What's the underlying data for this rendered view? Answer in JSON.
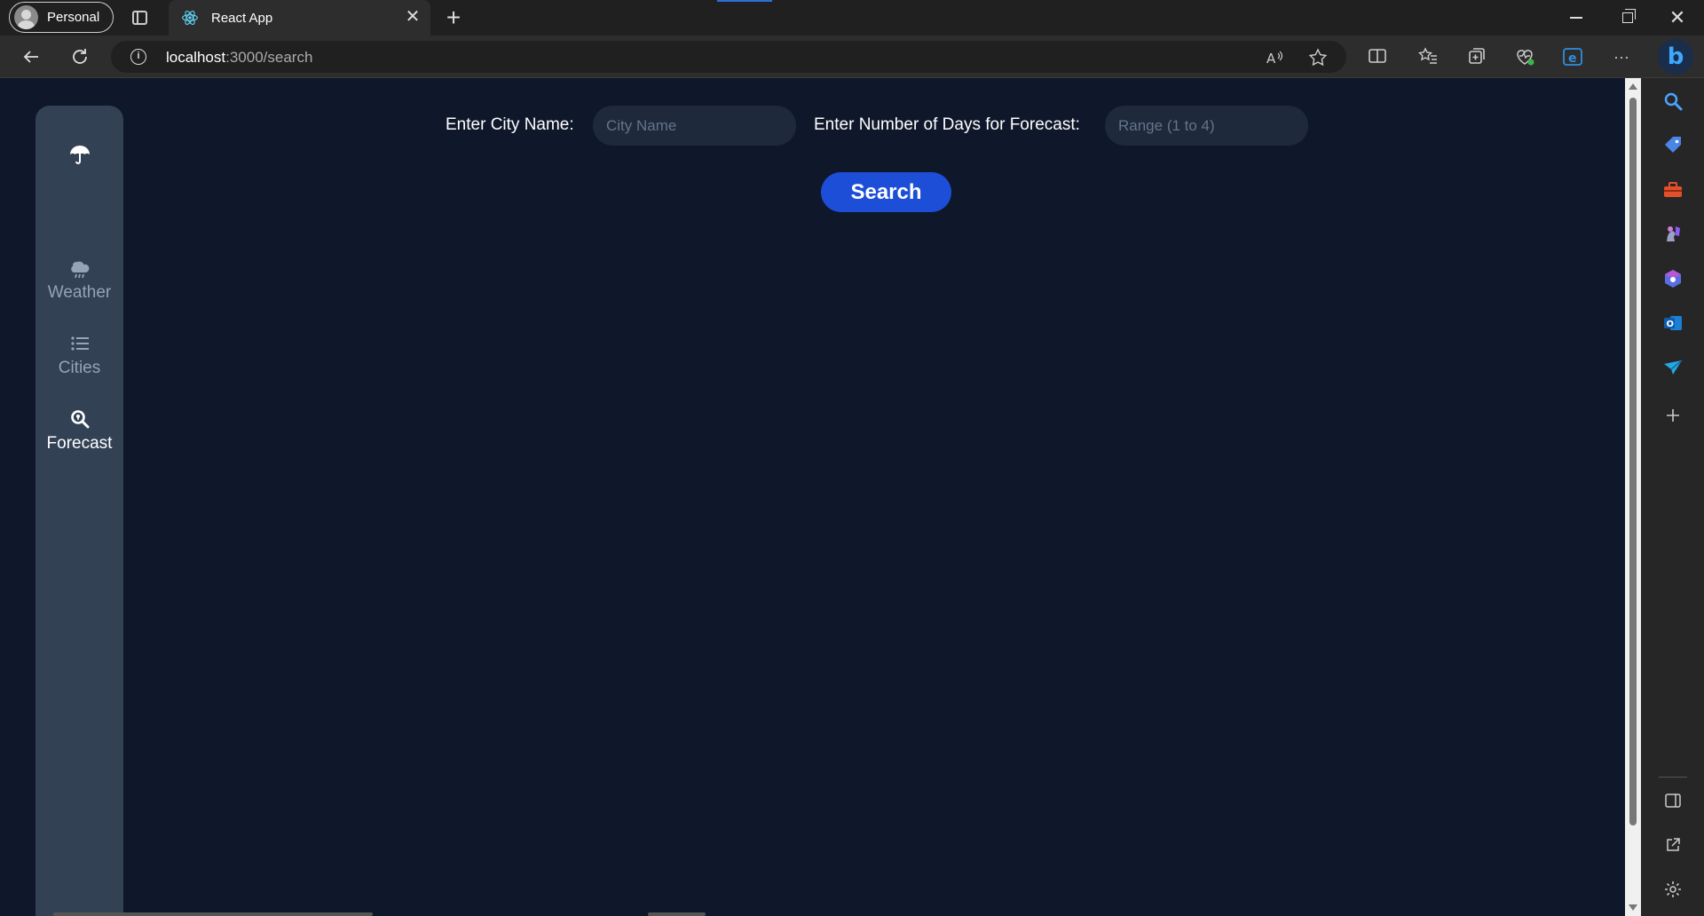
{
  "browser": {
    "profile_label": "Personal",
    "tab_title": "React App",
    "tab_close": "✕",
    "new_tab": "+",
    "url_host": "localhost",
    "url_path": ":3000/search",
    "more_label": "···"
  },
  "sidebar": {
    "items": [
      {
        "label": "Weather",
        "icon": "cloud-rain-icon"
      },
      {
        "label": "Cities",
        "icon": "list-icon"
      },
      {
        "label": "Forecast",
        "icon": "search-location-icon",
        "active": true
      }
    ]
  },
  "search": {
    "city_label": "Enter City Name:",
    "city_placeholder": "City Name",
    "days_label": "Enter Number of Days for Forecast:",
    "days_placeholder": "Range (1 to 4)",
    "button_label": "Search"
  },
  "colors": {
    "page_bg": "#0f172a",
    "sidebar_bg": "#334155",
    "input_bg": "#1e293b",
    "button_bg": "#1d4ed8"
  }
}
